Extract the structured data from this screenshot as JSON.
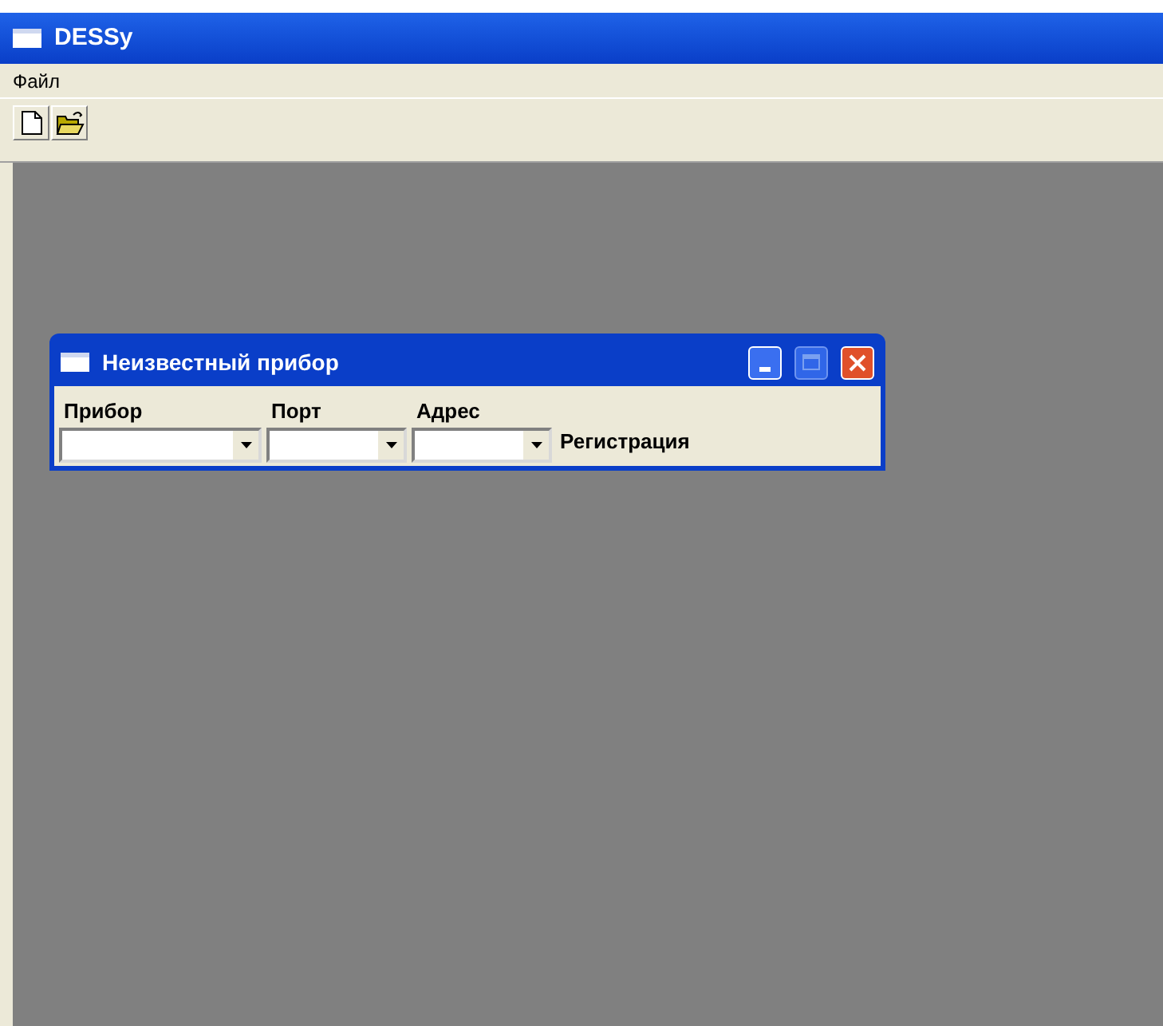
{
  "window": {
    "title": "DESSy"
  },
  "menu": [
    "Файл"
  ],
  "toolbar": [
    {
      "kind": "new"
    },
    {
      "kind": "open"
    }
  ],
  "child_window": {
    "title": "Неизвестный прибор",
    "maximize_disabled": true,
    "fields": [
      {
        "label": "Прибор"
      },
      {
        "label": "Порт"
      },
      {
        "label": "Адрес"
      }
    ],
    "registration": "Регистрация"
  }
}
